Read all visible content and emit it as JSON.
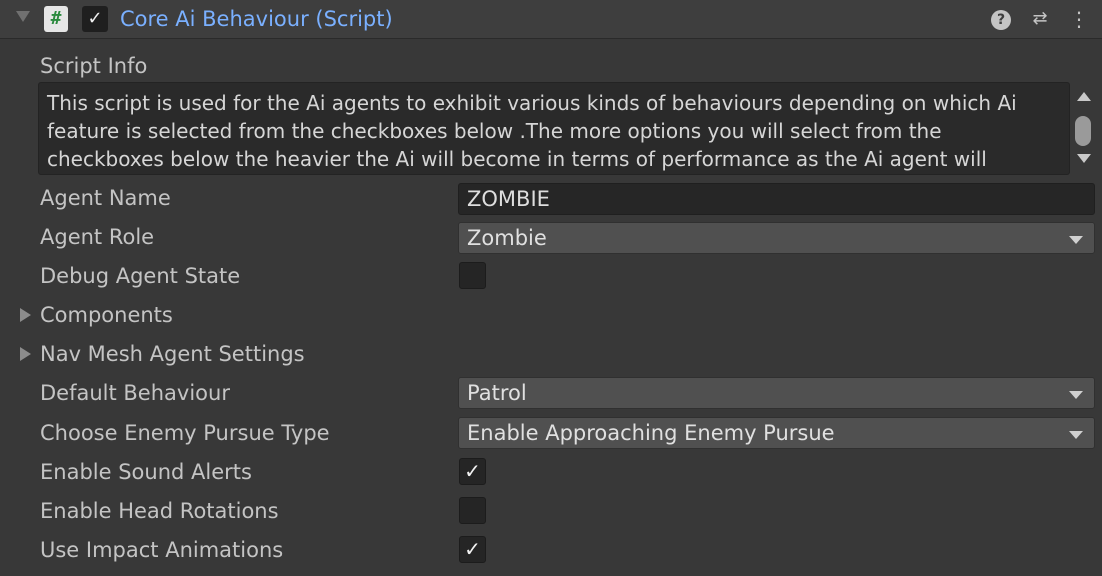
{
  "component": {
    "title": "Core Ai Behaviour (Script)",
    "script_icon_glyph": "#",
    "enabled": true,
    "icons": [
      "help-icon",
      "preset-icon",
      "menu-icon"
    ]
  },
  "script_info": {
    "label": "Script Info",
    "text": "This script is used for the Ai agents to exhibit various kinds of behaviours depending on which Ai feature is selected from the checkboxes below .The more options you will select from the checkboxes below the heavier the Ai will become in terms of performance as the Ai agent will"
  },
  "fields": {
    "agent_name": {
      "label": "Agent Name",
      "value": "ZOMBIE"
    },
    "agent_role": {
      "label": "Agent Role",
      "value": "Zombie"
    },
    "debug_agent_state": {
      "label": "Debug Agent State",
      "checked": false
    },
    "components": {
      "label": "Components",
      "expanded": false
    },
    "nav_mesh_agent_settings": {
      "label": "Nav Mesh Agent Settings",
      "expanded": false
    },
    "default_behaviour": {
      "label": "Default Behaviour",
      "value": "Patrol"
    },
    "enemy_pursue_type": {
      "label": "Choose Enemy Pursue Type",
      "value": "Enable Approaching Enemy Pursue"
    },
    "enable_sound_alerts": {
      "label": "Enable Sound Alerts",
      "checked": true
    },
    "enable_head_rotations": {
      "label": "Enable Head Rotations",
      "checked": false
    },
    "use_impact_animations": {
      "label": "Use Impact Animations",
      "checked": true
    }
  },
  "glyphs": {
    "check": "✓",
    "help": "?",
    "preset": "⇄",
    "menu": "⋮"
  },
  "colors": {
    "title_blue": "#7ab0ff",
    "background": "#383838",
    "field_dark": "#262626",
    "dropdown_bg": "#505050"
  }
}
